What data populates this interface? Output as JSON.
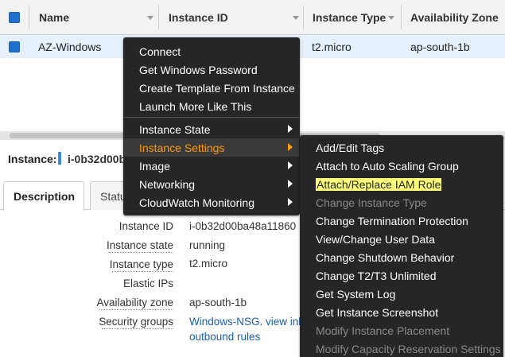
{
  "table": {
    "columns": [
      "Name",
      "Instance ID",
      "Instance Type",
      "Availability Zone"
    ],
    "row": {
      "name": "AZ-Windows",
      "type": "t2.micro",
      "zone": "ap-south-1b"
    }
  },
  "detail": {
    "label": "Instance:",
    "id_partial": "i-0b32d00b",
    "tabs": [
      "Description",
      "Statu"
    ],
    "fields": [
      {
        "label": "Instance ID",
        "value": "i-0b32d00ba48a11860"
      },
      {
        "label": "Instance state",
        "value": "running"
      },
      {
        "label": "Instance type",
        "value": "t2.micro"
      },
      {
        "label": "Elastic IPs",
        "value": ""
      },
      {
        "label": "Availability zone",
        "value": "ap-south-1b"
      },
      {
        "label": "Security groups",
        "value": "Windows-NSG. view inb",
        "value2": "outbound rules"
      }
    ]
  },
  "context_menu": {
    "items": [
      "Connect",
      "Get Windows Password",
      "Create Template From Instance",
      "Launch More Like This"
    ],
    "submenus": [
      "Instance State",
      "Instance Settings",
      "Image",
      "Networking",
      "CloudWatch Monitoring"
    ],
    "active": "Instance Settings",
    "accent": "#ff9900"
  },
  "settings_menu": {
    "items": [
      "Add/Edit Tags",
      "Attach to Auto Scaling Group",
      "Attach/Replace IAM Role",
      "Change Instance Type",
      "Change Termination Protection",
      "View/Change User Data",
      "Change Shutdown Behavior",
      "Change T2/T3 Unlimited",
      "Get System Log",
      "Get Instance Screenshot",
      "Modify Instance Placement",
      "Modify Capacity Reservation Settings"
    ],
    "highlighted": "Attach/Replace IAM Role",
    "disabled": [
      "Change Instance Type",
      "Modify Instance Placement",
      "Modify Capacity Reservation Settings"
    ],
    "highlight_color": "#ffff7a"
  }
}
